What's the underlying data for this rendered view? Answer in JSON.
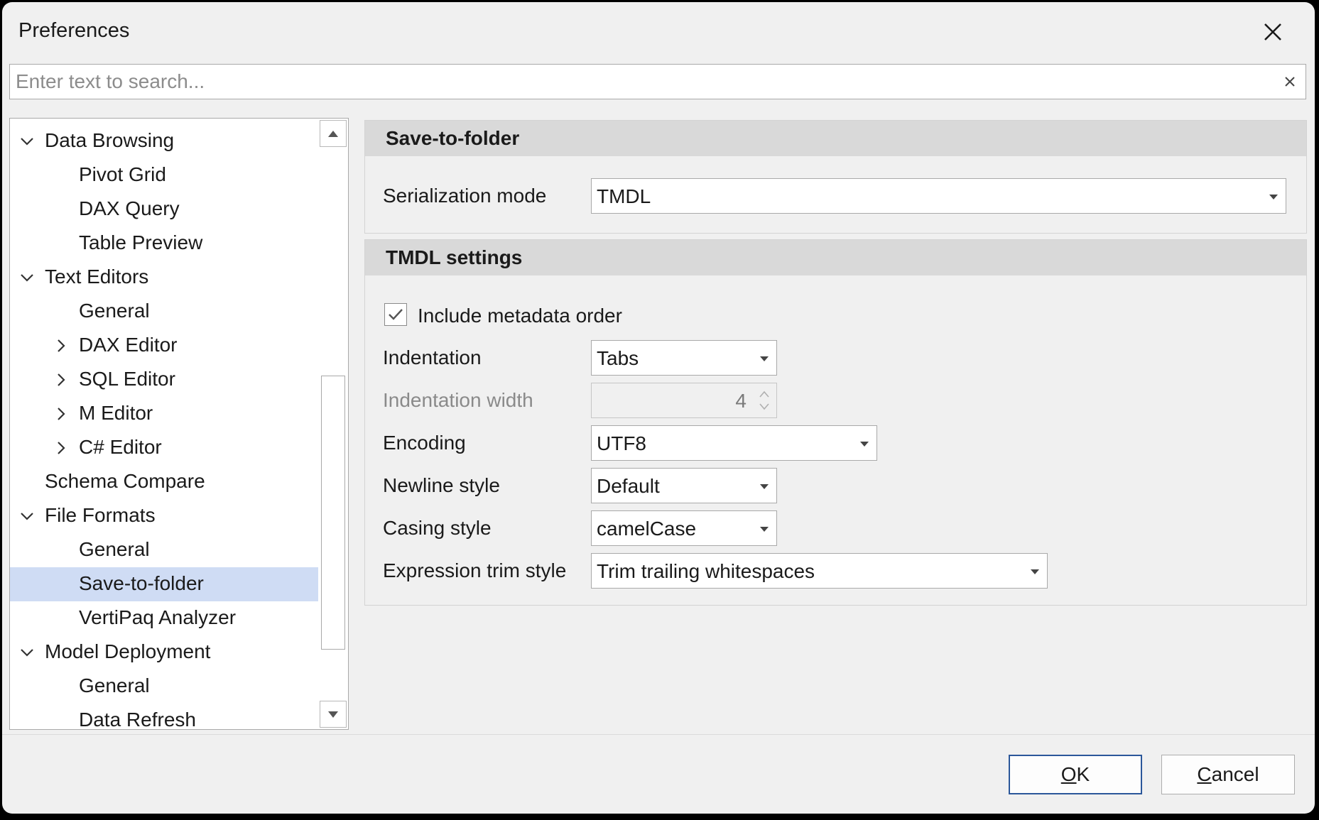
{
  "window": {
    "title": "Preferences"
  },
  "search": {
    "placeholder": "Enter text to search..."
  },
  "tree": {
    "items": [
      {
        "label": "Data Browsing",
        "level": 0,
        "expander": "expanded"
      },
      {
        "label": "Pivot Grid",
        "level": 1,
        "expander": "none"
      },
      {
        "label": "DAX Query",
        "level": 1,
        "expander": "none"
      },
      {
        "label": "Table Preview",
        "level": 1,
        "expander": "none"
      },
      {
        "label": "Text Editors",
        "level": 0,
        "expander": "expanded"
      },
      {
        "label": "General",
        "level": 1,
        "expander": "none"
      },
      {
        "label": "DAX Editor",
        "level": 1,
        "expander": "collapsed"
      },
      {
        "label": "SQL Editor",
        "level": 1,
        "expander": "collapsed"
      },
      {
        "label": "M Editor",
        "level": 1,
        "expander": "collapsed"
      },
      {
        "label": "C# Editor",
        "level": 1,
        "expander": "collapsed"
      },
      {
        "label": "Schema Compare",
        "level": 0,
        "expander": "none"
      },
      {
        "label": "File Formats",
        "level": 0,
        "expander": "expanded"
      },
      {
        "label": "General",
        "level": 1,
        "expander": "none"
      },
      {
        "label": "Save-to-folder",
        "level": 1,
        "expander": "none",
        "selected": true
      },
      {
        "label": "VertiPaq Analyzer",
        "level": 1,
        "expander": "none"
      },
      {
        "label": "Model Deployment",
        "level": 0,
        "expander": "expanded"
      },
      {
        "label": "General",
        "level": 1,
        "expander": "none"
      },
      {
        "label": "Data Refresh",
        "level": 1,
        "expander": "none"
      }
    ]
  },
  "save_to_folder": {
    "heading": "Save-to-folder",
    "serialization_mode_label": "Serialization mode",
    "serialization_mode_value": "TMDL"
  },
  "tmdl_settings": {
    "heading": "TMDL settings",
    "include_metadata_order_label": "Include metadata order",
    "include_metadata_order_checked": true,
    "indentation_label": "Indentation",
    "indentation_value": "Tabs",
    "indentation_width_label": "Indentation width",
    "indentation_width_value": "4",
    "encoding_label": "Encoding",
    "encoding_value": "UTF8",
    "newline_style_label": "Newline style",
    "newline_style_value": "Default",
    "casing_style_label": "Casing style",
    "casing_style_value": "camelCase",
    "expression_trim_style_label": "Expression trim style",
    "expression_trim_style_value": "Trim trailing whitespaces"
  },
  "footer": {
    "ok_accel": "O",
    "ok_rest": "K",
    "cancel_accel": "C",
    "cancel_rest": "ancel"
  },
  "colors": {
    "selection": "#cfdcf4",
    "group_header": "#d9d9d9",
    "primary_border": "#2b579a"
  },
  "icons": {
    "close": "close-icon",
    "clear_search": "clear-icon",
    "expanded": "chevron-down-icon",
    "collapsed": "chevron-right-icon",
    "combo": "dropdown-arrow-icon",
    "check": "checkmark-icon"
  }
}
